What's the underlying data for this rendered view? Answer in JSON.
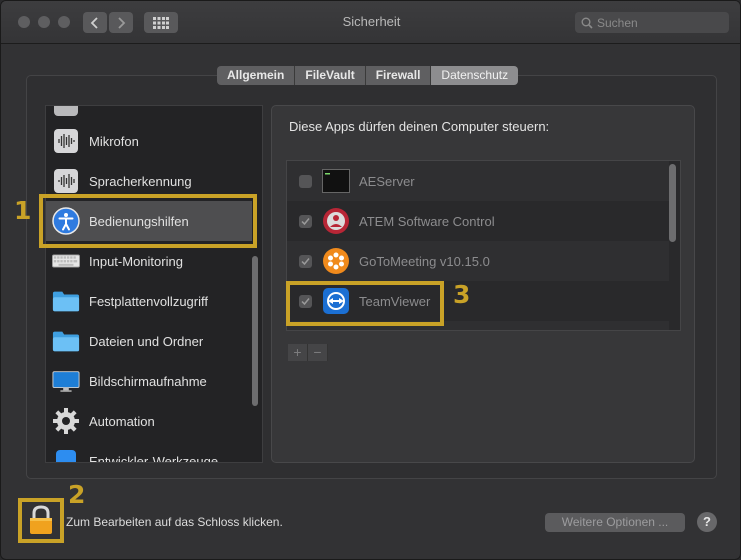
{
  "window": {
    "title": "Sicherheit"
  },
  "toolbar": {
    "back_glyph": "‹",
    "forward_glyph": "›"
  },
  "search": {
    "placeholder": "Suchen"
  },
  "tabs": [
    {
      "label": "Allgemein",
      "active": false
    },
    {
      "label": "FileVault",
      "active": false
    },
    {
      "label": "Firewall",
      "active": false
    },
    {
      "label": "Datenschutz",
      "active": true
    }
  ],
  "sidebar": {
    "items": [
      {
        "label": "Mikrofon",
        "icon": "microphone-waveform-icon"
      },
      {
        "label": "Spracherkennung",
        "icon": "speech-waveform-icon"
      },
      {
        "label": "Bedienungshilfen",
        "icon": "accessibility-icon",
        "selected": true
      },
      {
        "label": "Input-Monitoring",
        "icon": "keyboard-icon"
      },
      {
        "label": "Festplattenvollzugriff",
        "icon": "folder-icon"
      },
      {
        "label": "Dateien und Ordner",
        "icon": "folder-icon"
      },
      {
        "label": "Bildschirmaufnahme",
        "icon": "display-icon"
      },
      {
        "label": "Automation",
        "icon": "gear-icon"
      },
      {
        "label": "Entwickler-Werkzeuge",
        "icon": "developer-tools-icon"
      }
    ]
  },
  "panel": {
    "heading": "Diese Apps dürfen deinen Computer steuern:",
    "apps": [
      {
        "name": "AEServer",
        "checked": false,
        "icon": "terminal-icon"
      },
      {
        "name": "ATEM Software Control",
        "checked": true,
        "icon": "atem-icon"
      },
      {
        "name": "GoToMeeting v10.15.0",
        "checked": true,
        "icon": "gotomeeting-icon"
      },
      {
        "name": "TeamViewer",
        "checked": true,
        "icon": "teamviewer-icon"
      }
    ],
    "add_label": "+",
    "remove_label": "−"
  },
  "annotations": {
    "one": "1",
    "two": "2",
    "three": "3"
  },
  "footer": {
    "lock_text": "Zum Bearbeiten auf das Schloss klicken.",
    "options_button": "Weitere Optionen ...",
    "help_label": "?"
  },
  "colors": {
    "annotation": "#c9a227",
    "background": "#323234"
  }
}
